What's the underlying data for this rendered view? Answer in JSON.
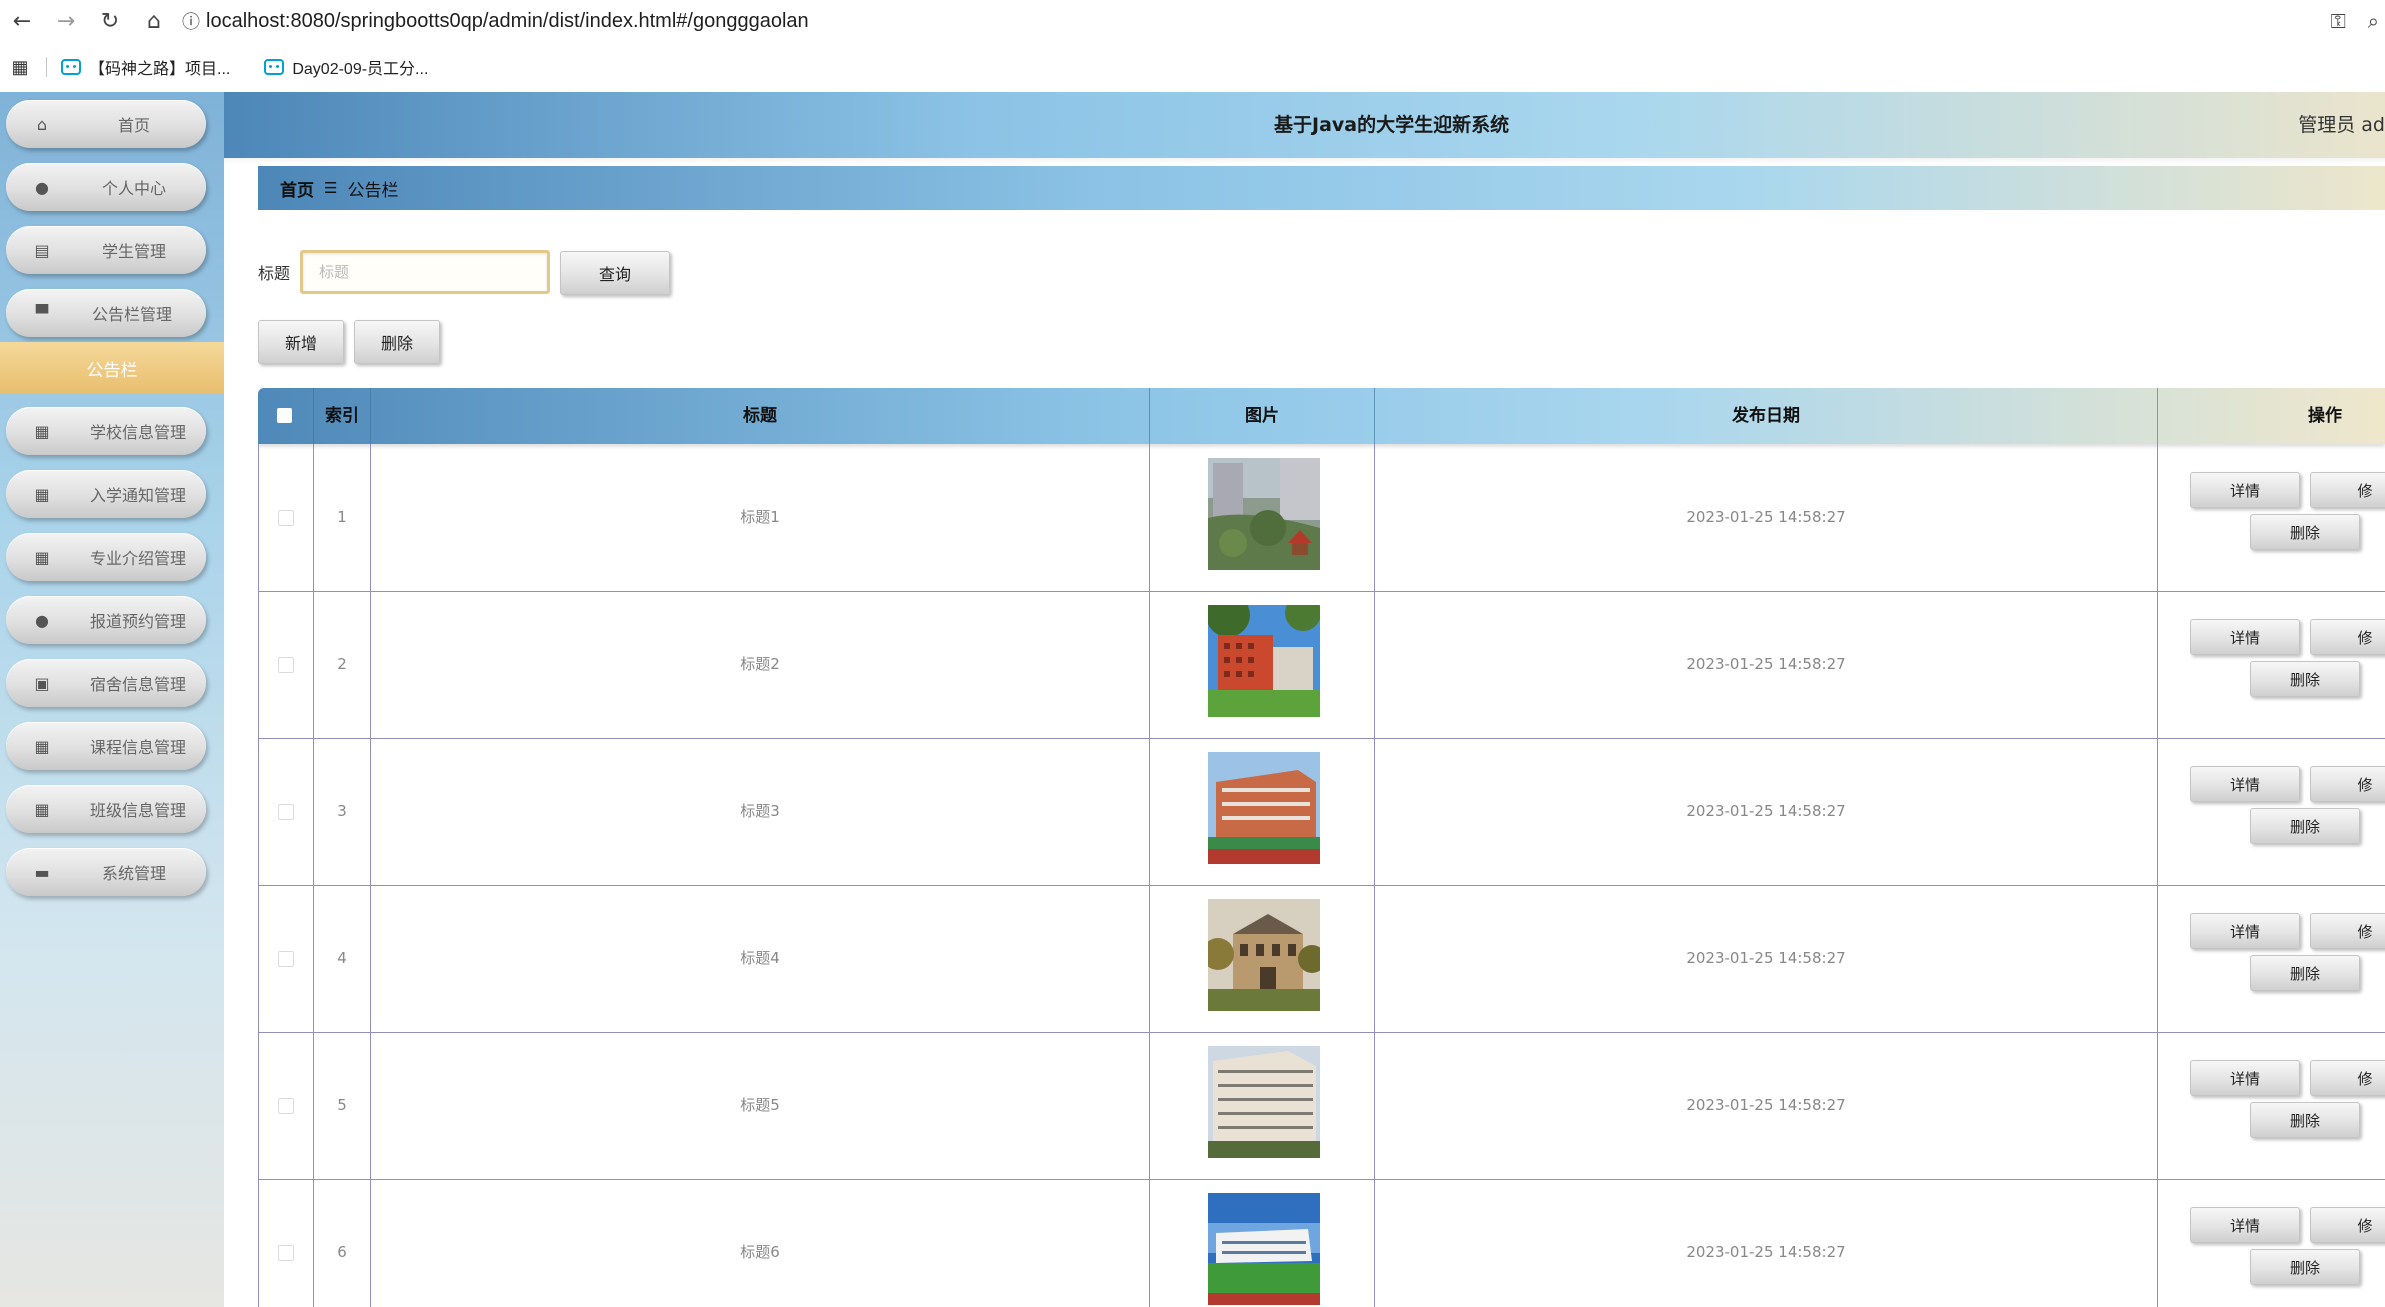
{
  "browser": {
    "url": "localhost:8080/springbootts0qp/admin/dist/index.html#/gongggaolan",
    "bookmarks": [
      "【码神之路】项目...",
      "Day02-09-员工分..."
    ]
  },
  "sidebar": {
    "items": [
      {
        "label": "首页",
        "icon": "home-icon",
        "glyph": "⌂"
      },
      {
        "label": "个人中心",
        "icon": "user-icon",
        "glyph": "●"
      },
      {
        "label": "学生管理",
        "icon": "chart-icon",
        "glyph": "▤"
      },
      {
        "label": "公告栏管理",
        "icon": "monitor-icon",
        "glyph": "▀"
      },
      {
        "label": "学校信息管理",
        "icon": "grid-icon",
        "glyph": "▦"
      },
      {
        "label": "入学通知管理",
        "icon": "grid-icon",
        "glyph": "▦"
      },
      {
        "label": "专业介绍管理",
        "icon": "grid-icon",
        "glyph": "▦"
      },
      {
        "label": "报道预约管理",
        "icon": "user-icon",
        "glyph": "●"
      },
      {
        "label": "宿舍信息管理",
        "icon": "clipboard-icon",
        "glyph": "▣"
      },
      {
        "label": "课程信息管理",
        "icon": "grid-icon",
        "glyph": "▦"
      },
      {
        "label": "班级信息管理",
        "icon": "grid-icon",
        "glyph": "▦"
      },
      {
        "label": "系统管理",
        "icon": "briefcase-icon",
        "glyph": "▬"
      }
    ],
    "active_label": "公告栏"
  },
  "header": {
    "title": "基于Java的大学生迎新系统",
    "admin": "管理员 ad"
  },
  "breadcrumb": {
    "home": "首页",
    "sep": "☰",
    "current": "公告栏"
  },
  "search": {
    "label": "标题",
    "placeholder": "标题",
    "value": "",
    "query_button": "查询"
  },
  "actions": {
    "add": "新增",
    "delete": "删除"
  },
  "table": {
    "columns": [
      "索引",
      "标题",
      "图片",
      "发布日期",
      "操作"
    ],
    "rows": [
      {
        "index": "1",
        "title": "标题1",
        "date": "2023-01-25 14:58:27",
        "image": "campus garden courtyard"
      },
      {
        "index": "2",
        "title": "标题2",
        "date": "2023-01-25 14:58:27",
        "image": "red brick building blue sky"
      },
      {
        "index": "3",
        "title": "标题3",
        "date": "2023-01-25 14:58:27",
        "image": "orange building with track"
      },
      {
        "index": "4",
        "title": "标题4",
        "date": "2023-01-25 14:58:27",
        "image": "ornate hall with trees"
      },
      {
        "index": "5",
        "title": "标题5",
        "date": "2023-01-25 14:58:27",
        "image": "white dormitory building"
      },
      {
        "index": "6",
        "title": "标题6",
        "date": "2023-01-25 14:58:27",
        "image": "white school with green field"
      }
    ],
    "row_buttons": {
      "detail": "详情",
      "edit": "修",
      "delete": "删除"
    }
  },
  "colors": {
    "accent_gold": "#e8be6e",
    "header_blue": "#4d87b8",
    "border": "#8f8fc2"
  }
}
